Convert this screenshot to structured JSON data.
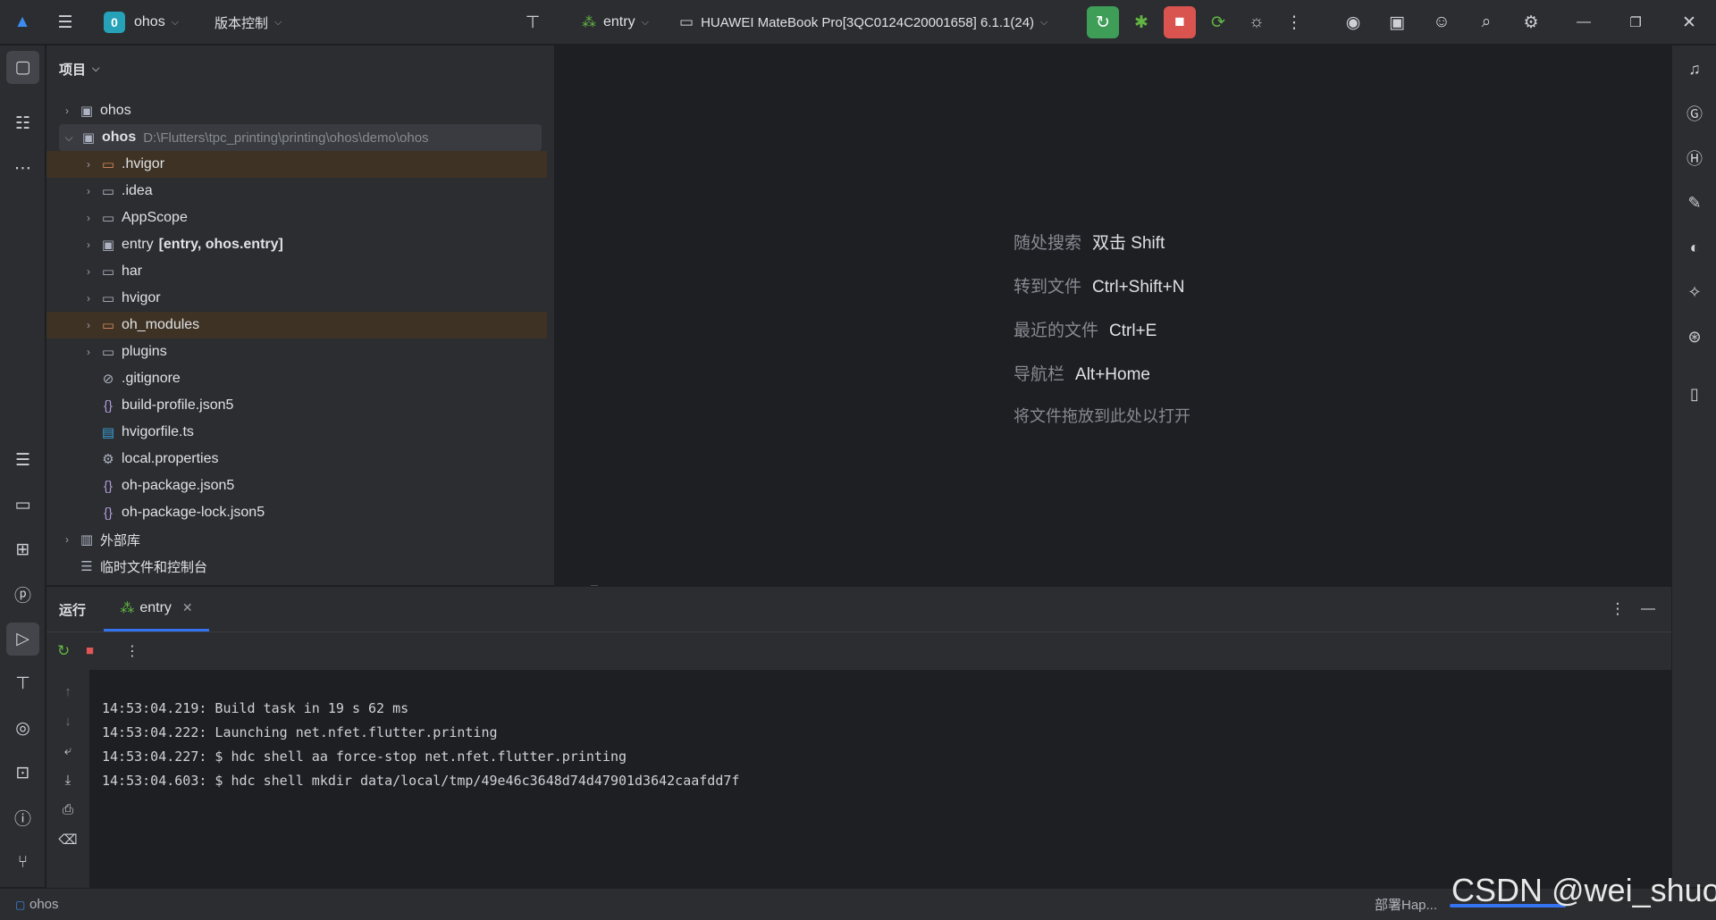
{
  "titlebar": {
    "project_badge": "0",
    "project_name": "ohos",
    "vcs_label": "版本控制",
    "run_config": "entry",
    "device": "HUAWEI MateBook Pro[3QC0124C20001658] 6.1.1(24)"
  },
  "project_panel": {
    "title": "项目",
    "tree": [
      {
        "label": "ohos",
        "path": "",
        "extra": ""
      },
      {
        "label": "ohos",
        "path": "D:\\Flutters\\tpc_printing\\printing\\ohos\\demo\\ohos",
        "extra": ""
      },
      {
        "label": ".hvigor",
        "path": "",
        "extra": ""
      },
      {
        "label": ".idea",
        "path": "",
        "extra": ""
      },
      {
        "label": "AppScope",
        "path": "",
        "extra": ""
      },
      {
        "label": "entry",
        "path": "",
        "extra": "[entry, ohos.entry]"
      },
      {
        "label": "har",
        "path": "",
        "extra": ""
      },
      {
        "label": "hvigor",
        "path": "",
        "extra": ""
      },
      {
        "label": "oh_modules",
        "path": "",
        "extra": ""
      },
      {
        "label": "plugins",
        "path": "",
        "extra": ""
      },
      {
        "label": ".gitignore",
        "path": "",
        "extra": ""
      },
      {
        "label": "build-profile.json5",
        "path": "",
        "extra": ""
      },
      {
        "label": "hvigorfile.ts",
        "path": "",
        "extra": ""
      },
      {
        "label": "local.properties",
        "path": "",
        "extra": ""
      },
      {
        "label": "oh-package.json5",
        "path": "",
        "extra": ""
      },
      {
        "label": "oh-package-lock.json5",
        "path": "",
        "extra": ""
      },
      {
        "label": "外部库",
        "path": "",
        "extra": ""
      },
      {
        "label": "临时文件和控制台",
        "path": "",
        "extra": ""
      }
    ]
  },
  "editor_hints": [
    {
      "key": "随处搜索",
      "value": "双击 Shift"
    },
    {
      "key": "转到文件",
      "value": "Ctrl+Shift+N"
    },
    {
      "key": "最近的文件",
      "value": "Ctrl+E"
    },
    {
      "key": "导航栏",
      "value": "Alt+Home"
    },
    {
      "key": "将文件拖放到此处以打开",
      "value": ""
    }
  ],
  "run_panel": {
    "title": "运行",
    "tab_label": "entry",
    "console": [
      "14:53:04.219: Build task in 19 s 62 ms",
      "14:53:04.222: Launching net.nfet.flutter.printing",
      "14:53:04.227: $ hdc shell aa force-stop net.nfet.flutter.printing",
      "14:53:04.603: $ hdc shell mkdir data/local/tmp/49e46c3648d74d47901d3642caafdd7f"
    ]
  },
  "statusbar": {
    "project": "ohos",
    "task": "部署Hap..."
  },
  "watermark": "CSDN @wei_shuo"
}
